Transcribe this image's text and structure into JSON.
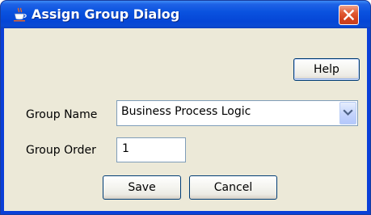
{
  "window": {
    "title": "Assign Group Dialog"
  },
  "toolbar": {
    "help_label": "Help"
  },
  "form": {
    "group_name": {
      "label": "Group Name",
      "selected_value": "Business Process Logic"
    },
    "group_order": {
      "label": "Group Order",
      "value": "1"
    }
  },
  "actions": {
    "save_label": "Save",
    "cancel_label": "Cancel"
  },
  "icons": {
    "app": "java-cup-icon",
    "close": "close-icon",
    "dropdown": "chevron-down-icon"
  },
  "colors": {
    "titlebar": "#0a52df",
    "close_button": "#e05a34",
    "dialog_background": "#ece9d8",
    "button_border": "#003c74",
    "field_border": "#7f9db9"
  }
}
